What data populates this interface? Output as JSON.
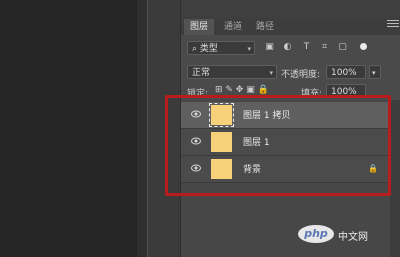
{
  "tabs": [
    "图层",
    "通道",
    "路径"
  ],
  "filter": {
    "label": "类型"
  },
  "blend_mode": "正常",
  "opacity": {
    "label": "不透明度:",
    "value": "100%"
  },
  "lock_row": {
    "label": "锁定:",
    "fill_label": "填充:",
    "fill_value": "100%"
  },
  "layers": [
    {
      "name": "图层 1 拷贝",
      "selected": true
    },
    {
      "name": "图层 1",
      "selected": false
    },
    {
      "name": "背景",
      "selected": false,
      "locked": true
    }
  ],
  "watermark": {
    "logo": "php",
    "text": "中文网"
  },
  "colors": {
    "layer_thumb": "#f7d17a",
    "highlight": "#b81c1c"
  }
}
